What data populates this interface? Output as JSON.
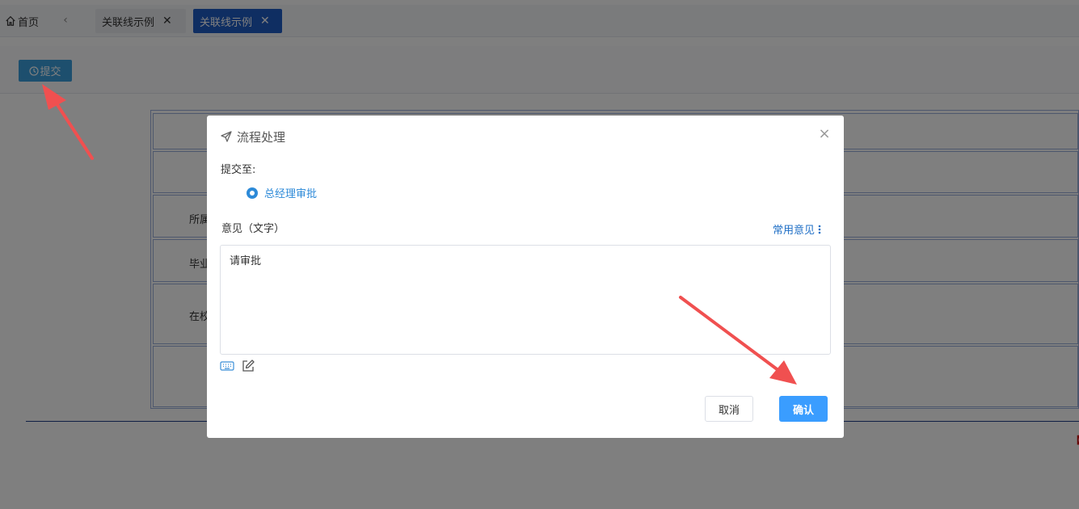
{
  "topbar": {
    "home_label": "首页",
    "tabs": [
      {
        "label": "关联线示例",
        "active": false
      },
      {
        "label": "关联线示例",
        "active": true
      }
    ]
  },
  "toolbar": {
    "submit_label": "提交"
  },
  "form": {
    "labels": [
      "所属",
      "毕业",
      "在校"
    ]
  },
  "bracket_text": "【",
  "dialog": {
    "title": "流程处理",
    "submit_to_label": "提交至:",
    "option_selected": "总经理审批",
    "opinion_label": "意见（文字）",
    "common_opinion_link": "常用意见",
    "opinion_value": "请审批",
    "cancel_label": "取消",
    "confirm_label": "确认"
  },
  "colors": {
    "active_tab": "#1f5cc4",
    "submit_button": "#3a9fdd",
    "confirm_button": "#3a9dff",
    "link": "#1f6fc6",
    "annotation_arrow": "#f05050"
  },
  "icons": [
    "home-icon",
    "chevron-left-icon",
    "close-icon",
    "clock-icon",
    "send-icon",
    "more-vertical-icon",
    "keyboard-icon",
    "edit-icon",
    "arrow-annotation"
  ]
}
